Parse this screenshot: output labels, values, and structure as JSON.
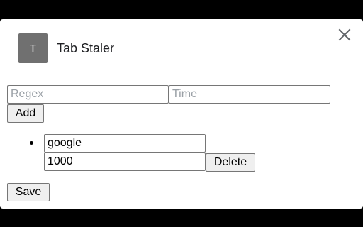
{
  "header": {
    "icon_letter": "T",
    "title": "Tab Staler"
  },
  "form": {
    "regex_placeholder": "Regex",
    "time_placeholder": "Time",
    "add_label": "Add"
  },
  "rules": [
    {
      "regex": "google",
      "time": "1000",
      "delete_label": "Delete"
    }
  ],
  "footer": {
    "save_label": "Save"
  }
}
